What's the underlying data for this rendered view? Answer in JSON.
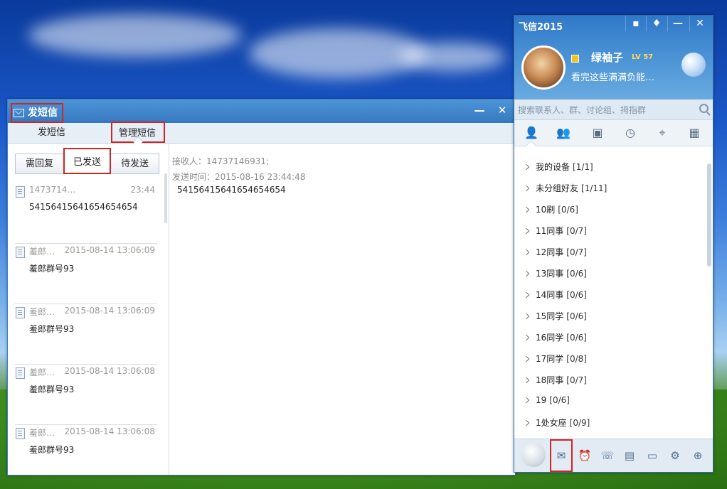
{
  "sms_window": {
    "title": "发短信",
    "tabs": [
      {
        "label": "发短信"
      },
      {
        "label": "管理短信"
      }
    ],
    "filters": [
      {
        "label": "需回复"
      },
      {
        "label": "已发送"
      },
      {
        "label": "待发送"
      }
    ],
    "messages": [
      {
        "who": "1473714…",
        "time": "23:44",
        "body": "54156415641654654654"
      },
      {
        "who": "羞郎…",
        "time": "2015-08-14 13:06:09",
        "body": "羞郎群号93"
      },
      {
        "who": "羞郎…",
        "time": "2015-08-14 13:06:09",
        "body": "羞郎群号93"
      },
      {
        "who": "羞郎…",
        "time": "2015-08-14 13:06:08",
        "body": "羞郎群号93"
      },
      {
        "who": "羞郎…",
        "time": "2015-08-14 13:06:08",
        "body": "羞郎群号93"
      }
    ],
    "detail": {
      "recipient": "接收人：14737146931;",
      "sent_time": "发送时间：2015-08-16 23:44:48",
      "body": "54156415641654654654"
    }
  },
  "fetion": {
    "title": "飞信2015",
    "nickname": "绿袖子",
    "vip": "LV 57",
    "signature": "看完这些满满负能…",
    "search_placeholder": "搜索联系人、群、讨论组、拇指群",
    "groups": [
      {
        "name": "我的设备",
        "count": "[1/1]"
      },
      {
        "name": "未分组好友",
        "count": "[1/11]"
      },
      {
        "name": "10刷",
        "count": "[0/6]"
      },
      {
        "name": "11同事",
        "count": "[0/7]"
      },
      {
        "name": "12同事",
        "count": "[0/7]"
      },
      {
        "name": "13同事",
        "count": "[0/6]"
      },
      {
        "name": "14同事",
        "count": "[0/6]"
      },
      {
        "name": "15同学",
        "count": "[0/6]"
      },
      {
        "name": "16同学",
        "count": "[0/6]"
      },
      {
        "name": "17同学",
        "count": "[0/8]"
      },
      {
        "name": "18同事",
        "count": "[0/7]"
      },
      {
        "name": "19",
        "count": "[0/6]"
      },
      {
        "name": "1处女座",
        "count": "[0/9]"
      }
    ]
  }
}
